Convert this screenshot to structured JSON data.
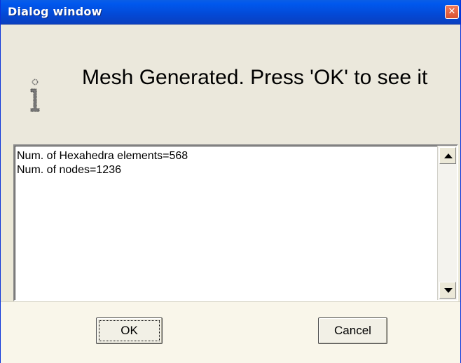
{
  "window": {
    "title": "Dialog window",
    "close_glyph": "✕"
  },
  "message": {
    "text": "Mesh Generated. Press 'OK' to see it",
    "icon": "info-icon"
  },
  "details": {
    "lines": [
      "Num. of Hexahedra elements=568",
      "Num. of nodes=1236"
    ]
  },
  "buttons": {
    "ok_label": "OK",
    "cancel_label": "Cancel"
  },
  "colors": {
    "titlebar": "#0349d6",
    "dialog_bg": "#ece9d8",
    "close_button": "#d9512f"
  }
}
